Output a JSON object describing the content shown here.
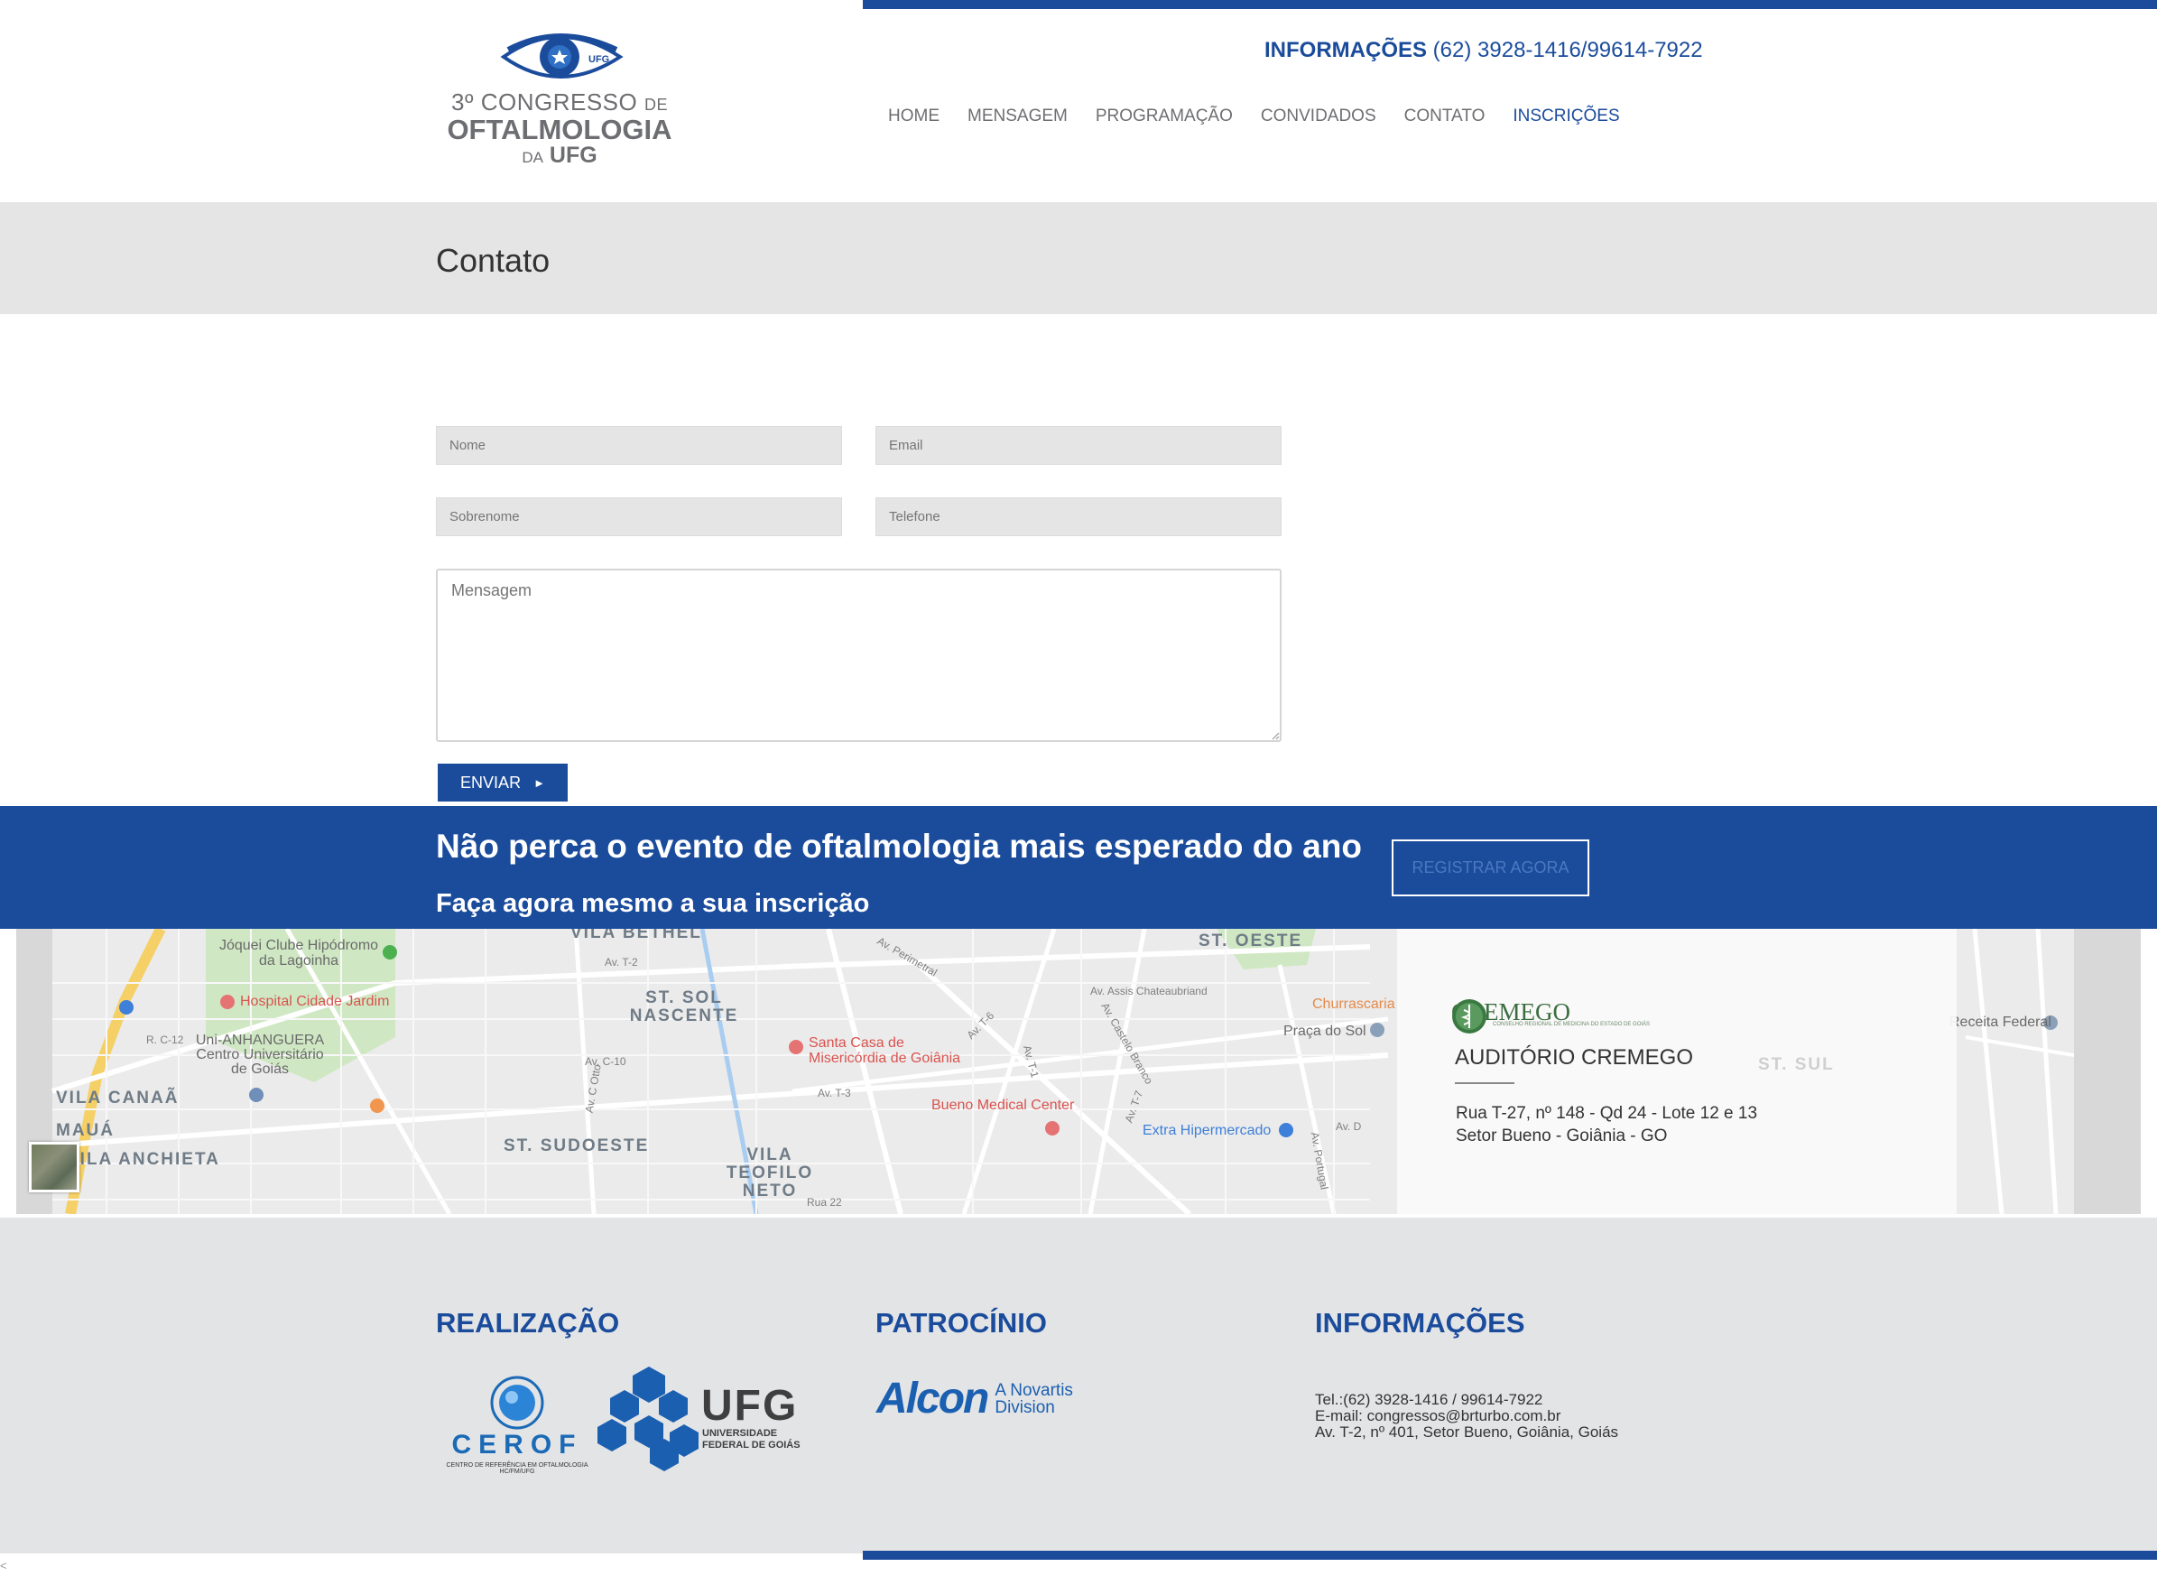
{
  "header": {
    "logo": {
      "line1": "3º CONGRESSO",
      "line1_small": "DE",
      "line2": "OFTALMOLOGIA",
      "line3_small": "DA",
      "line3": "UFG",
      "badge": "UFG"
    },
    "info_label": "INFORMAÇÕES",
    "info_phone": "(62) 3928-1416/99614-7922",
    "nav": [
      "HOME",
      "MENSAGEM",
      "PROGRAMAÇÃO",
      "CONVIDADOS",
      "CONTATO",
      "INSCRIÇÕES"
    ],
    "nav_active": "INSCRIÇÕES"
  },
  "page_title": "Contato",
  "form": {
    "nome_placeholder": "Nome",
    "email_placeholder": "Email",
    "sobrenome_placeholder": "Sobrenome",
    "telefone_placeholder": "Telefone",
    "mensagem_placeholder": "Mensagem",
    "send_label": "ENVIAR",
    "send_arrow": "►"
  },
  "cta": {
    "title": "Não perca o evento de oftalmologia mais esperado do ano",
    "subtitle": "Faça agora mesmo a sua inscrição",
    "button": "REGISTRAR AGORA"
  },
  "map": {
    "areas": [
      "VILA BETHEL",
      "ST. OESTE",
      "ST. SOL NASCENTE",
      "VILA CANAÃ",
      "MAUÁ",
      "VILA ANCHIETA",
      "ST. SUDOESTE",
      "VILA TEOFILO NETO",
      "ST. SUL"
    ],
    "pois": {
      "jockey": "Jóquei Clube Hipódromo da Lagoinha",
      "hospital": "Hospital Cidade Jardim",
      "uni": "Uni-ANHANGUERA Centro Universitário de Goiás",
      "santa_casa": "Santa Casa de Misericórdia de Goiânia",
      "bueno": "Bueno Medical Center",
      "extra": "Extra Hipermercado",
      "churrascaria": "Churrascaria",
      "praca": "Praça do Sol",
      "receita": "Receita Federal"
    },
    "streets": [
      "Av. T-2",
      "Av. Perimetral",
      "Av. Assis Chateaubriand",
      "Av. T-6",
      "Av. T-1",
      "Av. T-7",
      "Av. Castelo Branco",
      "Av. C-10",
      "Av. C Otto",
      "R. C-12",
      "Av. T-3",
      "Av. D",
      "Av. Portugal",
      "Rua 22"
    ],
    "overlay": {
      "logo_name": "CREMEGO",
      "logo_tagline": "CONSELHO REGIONAL DE MEDICINA DO ESTADO DE GOIÁS",
      "title": "AUDITÓRIO CREMEGO",
      "address_line1": "Rua T-27, nº 148 - Qd 24 - Lote 12 e 13",
      "address_line2": "Setor Bueno - Goiânia - GO"
    }
  },
  "footer": {
    "realizacao": "REALIZAÇÃO",
    "patrocinio": "PATROCÍNIO",
    "informacoes": "INFORMAÇÕES",
    "cerof_name": "CEROF",
    "cerof_sub": "CENTRO DE REFERÊNCIA EM OFTALMOLOGIA",
    "cerof_sub2": "HC/FM/UFG",
    "ufg_name": "UFG",
    "ufg_sub1": "UNIVERSIDADE",
    "ufg_sub2": "FEDERAL DE GOIÁS",
    "alcon_name": "Alcon",
    "alcon_sub1": "A Novartis",
    "alcon_sub2": "Division",
    "tel": "Tel.:(62) 3928-1416 / 99614-7922",
    "email": "E-mail: congressos@brturbo.com.br",
    "address": "Av. T-2, nº 401, Setor Bueno, Goiânia, Goiás"
  },
  "colors": {
    "brand_blue": "#1b4c9c",
    "band_gray": "#e5e5e5",
    "footer_gray": "#e3e4e6"
  }
}
